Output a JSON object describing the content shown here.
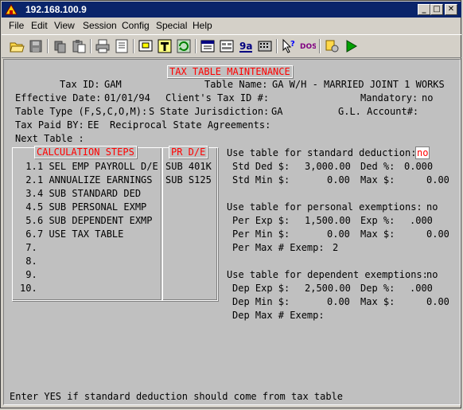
{
  "window": {
    "title": "192.168.100.9",
    "min": "_",
    "max": "□",
    "close": "✕"
  },
  "menu": [
    "File",
    "Edit",
    "View",
    "Session",
    "Config",
    "Special",
    "Help"
  ],
  "screen": {
    "heading": "TAX TABLE MAINTENANCE",
    "tax_id_label": "Tax ID:",
    "tax_id": "GAM",
    "table_name_label": "Table Name:",
    "table_name": "GA W/H - MARRIED JOINT 1 WORKS",
    "effective_date_label": "Effective Date:",
    "effective_date": "01/01/94",
    "clients_tax_id_label": "Client's Tax ID #:",
    "mandatory_label": "Mandatory:",
    "mandatory": "no",
    "table_type_label": "Table Type (F,S,C,O,M):",
    "table_type": "S",
    "state_jurisdiction_label": "State Jurisdiction:",
    "state_jurisdiction": "GA",
    "gl_account_label": "G.L. Account#:",
    "tax_paid_by_label": "Tax Paid BY:",
    "tax_paid_by": "EE",
    "reciprocal_label": "Reciprocal State Agreements:",
    "next_table_label": "Next Table :",
    "calc_steps_title": "CALCULATION STEPS",
    "calc_steps": [
      {
        "n": " 1.",
        "text": "1 SEL EMP PAYROLL D/E"
      },
      {
        "n": " 2.",
        "text": "1 ANNUALIZE EARNINGS"
      },
      {
        "n": " 3.",
        "text": "4 SUB STANDARD DED"
      },
      {
        "n": " 4.",
        "text": "5 SUB PERSONAL EXMP"
      },
      {
        "n": " 5.",
        "text": "6 SUB DEPENDENT EXMP"
      },
      {
        "n": " 6.",
        "text": "7 USE TAX TABLE"
      },
      {
        "n": " 7.",
        "text": ""
      },
      {
        "n": " 8.",
        "text": ""
      },
      {
        "n": " 9.",
        "text": ""
      },
      {
        "n": "10.",
        "text": ""
      }
    ],
    "pr_de_title": "PR D/E",
    "pr_de": [
      "SUB 401K",
      "SUB S125"
    ],
    "std": {
      "use_label": "Use table for standard deduction:",
      "use": "no",
      "ded_label": "Std Ded $:",
      "ded": "3,000.00",
      "ded_pct_label": "Ded %:",
      "ded_pct": "0.000",
      "min_label": "Std Min $:",
      "min": "0.00",
      "max_label": "Max $:",
      "max": "0.00"
    },
    "per": {
      "use_label": "Use table for personal exemptions:",
      "use": "no",
      "exp_label": "Per Exp $:",
      "exp": "1,500.00",
      "exp_pct_label": "Exp %:",
      "exp_pct": ".000",
      "min_label": "Per Min $:",
      "min": "0.00",
      "max_label": "Max $:",
      "max": "0.00",
      "max_exemp_label": "Per Max # Exemp:",
      "max_exemp": "2"
    },
    "dep": {
      "use_label": "Use table for dependent exemptions:",
      "use": "no",
      "exp_label": "Dep Exp $:",
      "exp": "2,500.00",
      "exp_pct_label": "Dep %:",
      "exp_pct": ".000",
      "min_label": "Dep Min $:",
      "min": "0.00",
      "max_label": "Max $:",
      "max": "0.00",
      "max_exemp_label": "Dep Max # Exemp:"
    },
    "status_line": "Enter YES if standard deduction should come from tax table"
  }
}
